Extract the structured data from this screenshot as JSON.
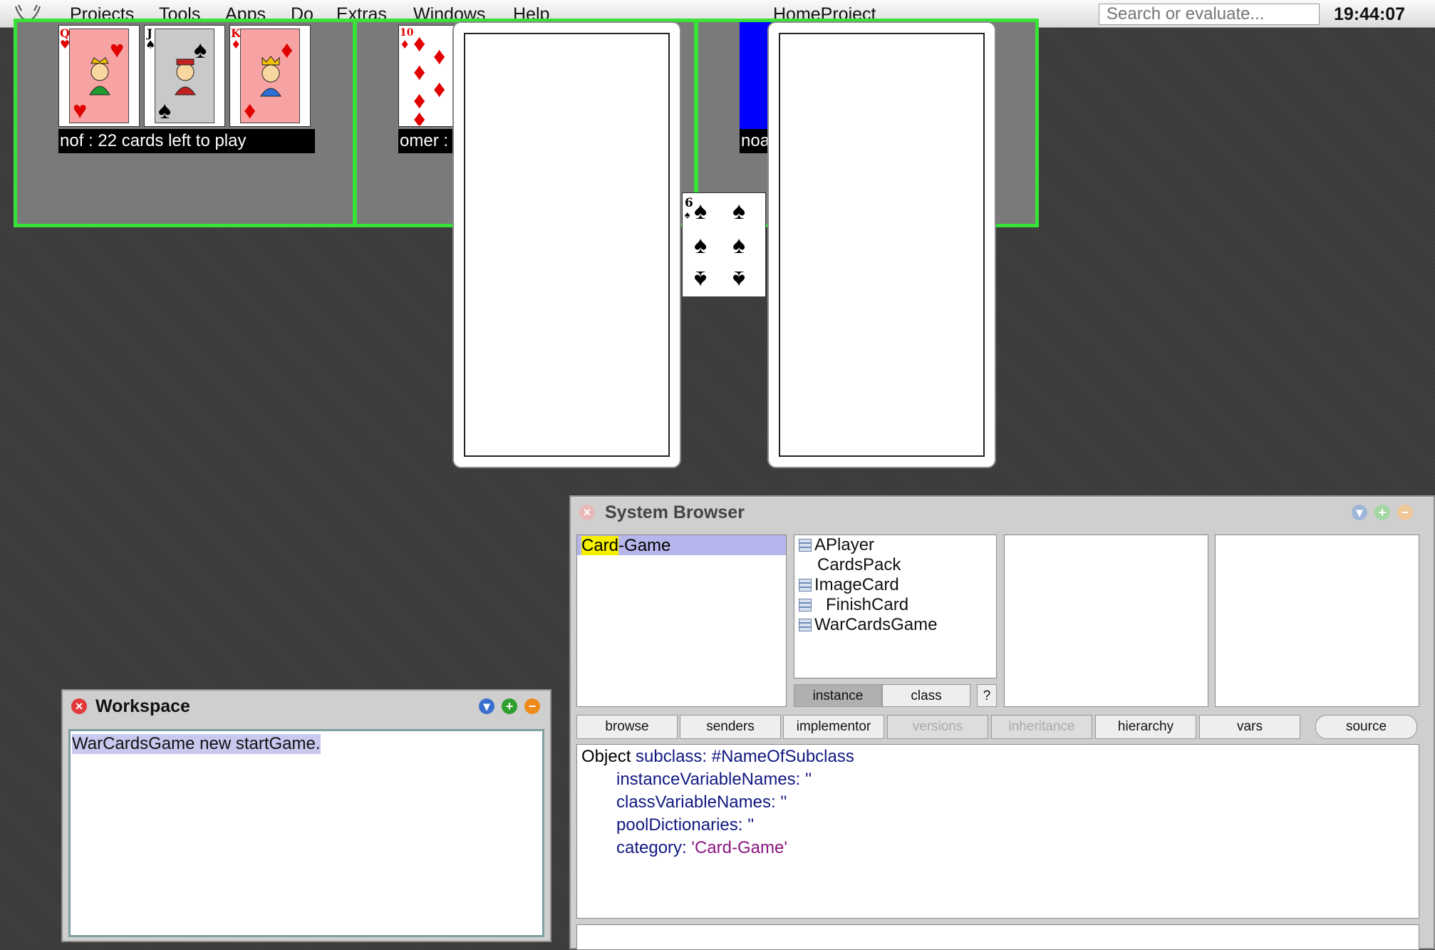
{
  "menubar": {
    "items": [
      "Projects",
      "Tools",
      "Apps",
      "Do",
      "Extras",
      "Windows",
      "Help"
    ],
    "project_title": "HomeProject",
    "search_placeholder": "Search or evaluate...",
    "clock": "19:44:07"
  },
  "game": {
    "players": [
      {
        "label": "nof : 22 cards left to play",
        "cards": [
          {
            "rank": "Q",
            "suit": "♥",
            "color": "#e00000"
          },
          {
            "rank": "J",
            "suit": "♠",
            "color": "#000000"
          },
          {
            "rank": "K",
            "suit": "♦",
            "color": "#e00000"
          }
        ]
      },
      {
        "label": "omer :",
        "cards": [
          {
            "rank": "10",
            "suit": "♦",
            "color": "#e00000"
          }
        ]
      },
      {
        "label": "noa",
        "cards": []
      }
    ],
    "center_card": {
      "rank": "6",
      "suit": "♠"
    },
    "colors": {
      "panel_border": "#37e337",
      "card_back": "#0000ff"
    }
  },
  "system_browser": {
    "title": "System Browser",
    "categories": [
      "Card-Game"
    ],
    "category_highlight": "Card",
    "category_rest": "-Game",
    "classes": [
      "APlayer",
      "CardsPack",
      "ImageCard",
      "FinishCard",
      "WarCardsGame"
    ],
    "toggle": {
      "instance": "instance",
      "class": "class",
      "help": "?"
    },
    "buttons": [
      "browse",
      "senders",
      "implementor",
      "versions",
      "inheritance",
      "hierarchy",
      "vars",
      "source"
    ],
    "code": {
      "receiver": "Object",
      "line1_rest": " subclass: #NameOfSubclass",
      "line2": "instanceVariableNames: ''",
      "line3": "classVariableNames: ''",
      "line4": "poolDictionaries: ''",
      "line5_key": "category: ",
      "line5_value": "'Card-Game'"
    }
  },
  "workspace": {
    "title": "Workspace",
    "content": "WarCardsGame new startGame."
  }
}
